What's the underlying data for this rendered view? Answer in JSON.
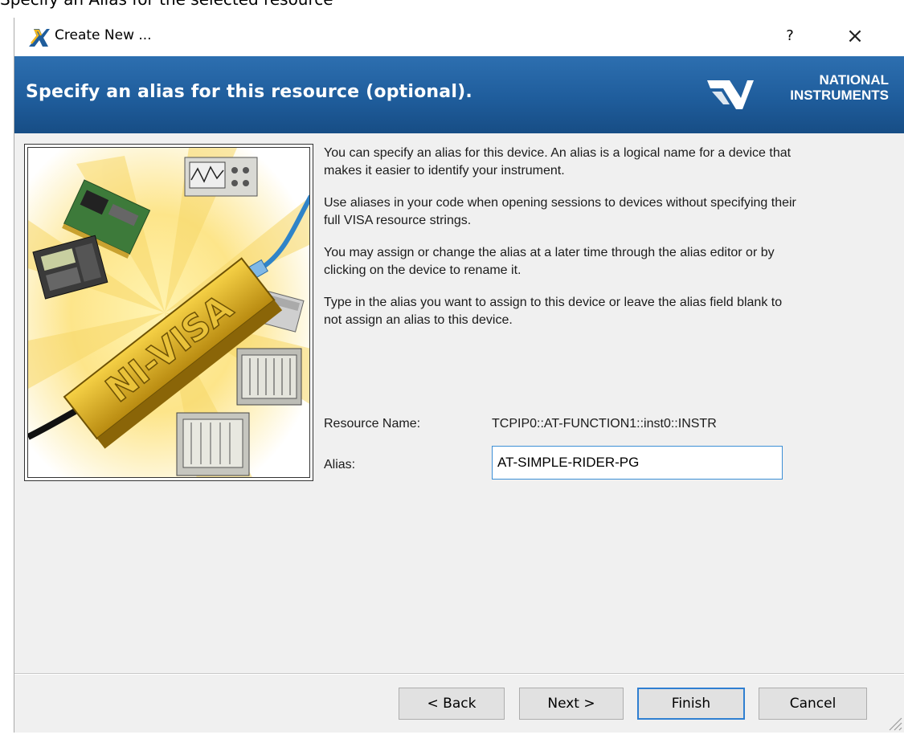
{
  "doc_heading": "Specify an Alias for the selected resource",
  "window": {
    "title": "Create New ...",
    "help_label": "?",
    "close_label": "×"
  },
  "banner": {
    "title": "Specify an alias for this resource (optional).",
    "logo_line1": "NATIONAL",
    "logo_line2": "INSTRUMENTS"
  },
  "picture": {
    "product_text": "NI-VISA"
  },
  "content": {
    "paragraphs": [
      "You can specify an alias for this device. An alias is a logical name for a device that makes it easier to identify your instrument.",
      "Use aliases in your code when opening sessions to devices without specifying their full VISA resource strings.",
      "You may assign or change the alias at a later time through the alias editor or by clicking on the device to rename it.",
      "Type in the alias you want to assign to this device or leave the alias field blank to not assign an alias to this device."
    ],
    "resource_name_label": "Resource Name:",
    "resource_name_value": "TCPIP0::AT-FUNCTION1::inst0::INSTR",
    "alias_label": "Alias:",
    "alias_value": "AT-SIMPLE-RIDER-PG"
  },
  "buttons": {
    "back": "< Back",
    "next": "Next >",
    "finish": "Finish",
    "cancel": "Cancel"
  },
  "colors": {
    "banner": "#1f5d9c",
    "focus_border": "#2f7fd1",
    "window_bg": "#f0f0f0"
  }
}
